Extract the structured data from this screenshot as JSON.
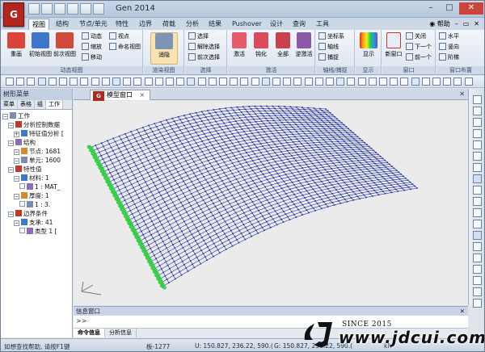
{
  "app": {
    "title": "Gen 2014",
    "logo_text": "G"
  },
  "ribbon_tabs": [
    "视图",
    "结构",
    "节点/单元",
    "特性",
    "边界",
    "荷载",
    "分析",
    "结果",
    "Pushover",
    "设计",
    "查询",
    "工具"
  ],
  "help": {
    "label": "帮助"
  },
  "ribbon": {
    "groups": [
      {
        "label": "动态视图",
        "big": [
          "重画",
          "初始视图",
          "前次视图"
        ],
        "small": [
          "动态",
          "缩放",
          "移动",
          "视点",
          "命名视图"
        ]
      },
      {
        "label": "渲染视图",
        "big": [
          "消隐"
        ]
      },
      {
        "label": "选择",
        "small": [
          "选择",
          "解除选择",
          "前次选择"
        ]
      },
      {
        "label": "激活",
        "big": [
          "激活",
          "钝化",
          "全部",
          "逆激活"
        ]
      },
      {
        "label": "轴线/捕捉",
        "small": [
          "坐标系",
          "轴线",
          "捕捉"
        ]
      },
      {
        "label": "显示",
        "big": [
          "显示"
        ]
      },
      {
        "label": "窗口",
        "big": [
          "新窗口"
        ],
        "small": [
          "关闭",
          "下一个",
          "前一个"
        ]
      },
      {
        "label": "窗口布置",
        "small": [
          "水平",
          "竖向",
          "阶梯"
        ]
      }
    ]
  },
  "left_panel": {
    "title": "树形菜单",
    "tabs": [
      "菜单",
      "表格",
      "组",
      "工作"
    ],
    "active_tab": "工作",
    "tree": [
      {
        "label": "工作",
        "level": 0
      },
      {
        "label": "分析控制数据",
        "level": 1
      },
      {
        "label": "特征值分析 [",
        "level": 2
      },
      {
        "label": "结构",
        "level": 1
      },
      {
        "label": "节点: 1681",
        "level": 2
      },
      {
        "label": "单元: 1600",
        "level": 2
      },
      {
        "label": "特性值",
        "level": 1
      },
      {
        "label": "材料: 1",
        "level": 2
      },
      {
        "label": "1 : MAT_",
        "level": 3
      },
      {
        "label": "厚度: 1",
        "level": 2
      },
      {
        "label": "1 : 3.",
        "level": 3
      },
      {
        "label": "边界条件",
        "level": 1
      },
      {
        "label": "支承: 41",
        "level": 2
      },
      {
        "label": "类型 1 [",
        "level": 3
      }
    ]
  },
  "doc_tab": {
    "label": "模型窗口",
    "close": "×"
  },
  "info_panel": {
    "title": "信息窗口",
    "prompt": ">>",
    "tabs": [
      "命令信息",
      "分析信息"
    ],
    "active_tab": "命令信息"
  },
  "status": {
    "hint": "如想查找帮助, 请按F1键",
    "selection": "板-1277",
    "u_coord": "U: 150.827, 236.22, 590.(",
    "g_coord": "G: 150.827, 236.22, 590.(",
    "unit": "kN"
  },
  "mesh": {
    "rows": 40,
    "cols": 40,
    "line_color": "#1e2fa8",
    "node_color": "#1e2fa8",
    "support_color": "#3ce04a"
  },
  "watermark": {
    "since": "SINCE 2015",
    "url": "www.jdcui.com"
  }
}
